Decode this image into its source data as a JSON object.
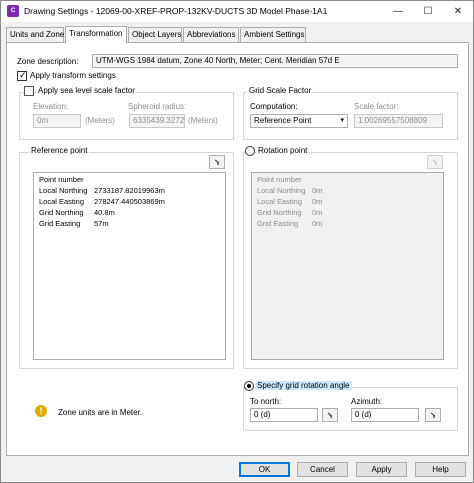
{
  "window": {
    "title": "Drawing Settings - 12069-00-XREF-PROP-132KV-DUCTS 3D Model Phase-1A1",
    "app_icon_text": "C",
    "controls": [
      "—",
      "☐",
      "✕"
    ]
  },
  "tabs": [
    {
      "label": "Units and Zone",
      "active": false
    },
    {
      "label": "Transformation",
      "active": true
    },
    {
      "label": "Object Layers",
      "active": false
    },
    {
      "label": "Abbreviations",
      "active": false
    },
    {
      "label": "Ambient Settings",
      "active": false
    }
  ],
  "zone": {
    "label": "Zone description:",
    "value": "UTM-WGS 1984 datum, Zone 40 North, Meter; Cent. Meridian 57d E"
  },
  "apply_transform": {
    "label": "Apply transform settings",
    "checked": true
  },
  "sea_level": {
    "label": "Apply sea level scale factor",
    "checked": false,
    "elevation_label": "Elevation:",
    "elevation_value": "0m",
    "elevation_unit": "(Meters)",
    "spheroid_label": "Spheroid radius:",
    "spheroid_value": "6335439.3272",
    "spheroid_unit": "(Meters)"
  },
  "grid_scale": {
    "title": "Grid Scale Factor",
    "computation_label": "Computation:",
    "computation_value": "Reference Point",
    "scale_label": "Scale factor:",
    "scale_value": "1.00269557508809"
  },
  "reference_point": {
    "title": "Reference point",
    "rows": [
      {
        "name": "Point number",
        "value": ""
      },
      {
        "name": "Local Northing",
        "value": "2733187.82019963m"
      },
      {
        "name": "Local Easting",
        "value": "278247.440503869m"
      },
      {
        "name": "Grid Northing",
        "value": "40.8m"
      },
      {
        "name": "Grid Easting",
        "value": "57m"
      }
    ]
  },
  "rotation_point": {
    "label": "Rotation point",
    "selected": false,
    "rows": [
      {
        "name": "Point number",
        "value": ""
      },
      {
        "name": "Local Northing",
        "value": "0m"
      },
      {
        "name": "Local Easting",
        "value": "0m"
      },
      {
        "name": "Grid Northing",
        "value": "0m"
      },
      {
        "name": "Grid Easting",
        "value": "0m"
      }
    ]
  },
  "grid_rotation": {
    "label": "Specify grid rotation angle",
    "selected": true,
    "to_north_label": "To north:",
    "to_north_value": "0 (d)",
    "azimuth_label": "Azimuth:",
    "azimuth_value": "0 (d)"
  },
  "info": {
    "text": "Zone units are in Meter."
  },
  "buttons": {
    "ok": "OK",
    "cancel": "Cancel",
    "apply": "Apply",
    "help": "Help"
  },
  "icons": {
    "pick": "⭸",
    "warning": "!"
  }
}
